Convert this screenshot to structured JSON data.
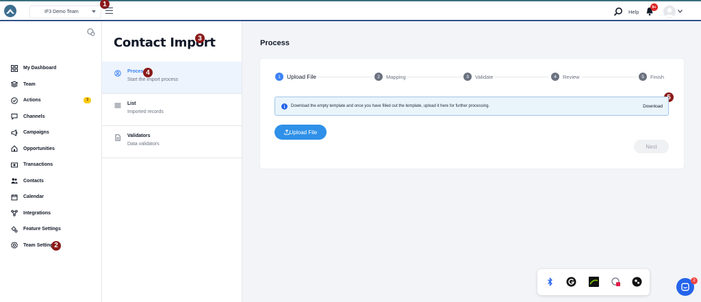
{
  "topbar": {
    "team_name": "IF3 Demo Team",
    "help_label": "Help",
    "notifications_badge": "9+"
  },
  "markers": [
    "1",
    "2",
    "3",
    "4",
    "5"
  ],
  "sidebar": {
    "items": [
      {
        "label": "My Dashboard",
        "icon": "dashboard-icon"
      },
      {
        "label": "Team",
        "icon": "layers-icon"
      },
      {
        "label": "Actions",
        "icon": "check-circle-icon",
        "badge": "3"
      },
      {
        "label": "Channels",
        "icon": "chat-icon"
      },
      {
        "label": "Campaigns",
        "icon": "megaphone-icon"
      },
      {
        "label": "Opportunities",
        "icon": "home-icon"
      },
      {
        "label": "Transactions",
        "icon": "money-icon"
      },
      {
        "label": "Contacts",
        "icon": "users-icon"
      },
      {
        "label": "Calendar",
        "icon": "calendar-icon"
      },
      {
        "label": "Integrations",
        "icon": "network-icon"
      },
      {
        "label": "Feature Settings",
        "icon": "settings-cog-icon"
      },
      {
        "label": "Team Settings",
        "icon": "gear-icon"
      }
    ]
  },
  "import_panel": {
    "title": "Contact Import",
    "items": [
      {
        "title": "Process",
        "subtitle": "Start the import process"
      },
      {
        "title": "List",
        "subtitle": "Imported records"
      },
      {
        "title": "Validators",
        "subtitle": "Data validators"
      }
    ]
  },
  "main": {
    "title": "Process",
    "steps": [
      {
        "num": "1",
        "label": "Upload File"
      },
      {
        "num": "2",
        "label": "Mapping"
      },
      {
        "num": "3",
        "label": "Validate"
      },
      {
        "num": "4",
        "label": "Review"
      },
      {
        "num": "5",
        "label": "Finish"
      }
    ],
    "info_text": "Download the empty template and once you have filled out the template, upload it here for further processing.",
    "download_label": "Download",
    "upload_label": "Upload File",
    "next_label": "Next"
  },
  "chat_badge": "2",
  "colors": {
    "accent": "#2e90e8",
    "marker": "#8b1a1a",
    "info_bg": "#eaf4fb"
  }
}
